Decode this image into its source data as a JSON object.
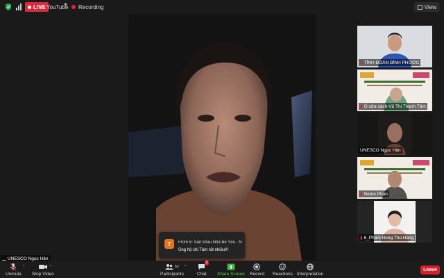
{
  "topbar": {
    "live_label": "LIVE",
    "stream_target": "on YouTube",
    "recording_label": "Recording",
    "view_label": "View"
  },
  "thumbnails": [
    {
      "name": "TỈNH ĐOÀN BÌNH PHƯỚC",
      "muted": true
    },
    {
      "name": "Ô cửa sách-Vũ Thị Thanh Tâm",
      "muted": true
    },
    {
      "name": "UNESCO Ngọc Hân",
      "muted": false
    },
    {
      "name": "Nemo Phan",
      "muted": true
    },
    {
      "name": "6_Pham Hong Thu Hang",
      "muted": true
    }
  ],
  "self_label": "UNESCO Ngọc Hân",
  "toast": {
    "avatar_letter": "T",
    "from": "From 8- Sân khấu Nhà Bè Yêu - N...",
    "message": "Ủng hộ chị Tâm rất nhiều!!!"
  },
  "toolbar": {
    "unmute": "Unmute",
    "stop_video": "Stop Video",
    "participants": "Participants",
    "participants_count": "52",
    "chat": "Chat",
    "chat_badge": "5",
    "share_screen": "Share Screen",
    "record": "Record",
    "reactions": "Reactions",
    "interpretation": "Interpretation",
    "leave": "Leave"
  },
  "colors": {
    "live_red": "#e0263a",
    "share_green": "#5fcf4f",
    "active_border": "#7fd35b",
    "leave_red": "#d6202e",
    "toast_avatar": "#e8741f"
  }
}
